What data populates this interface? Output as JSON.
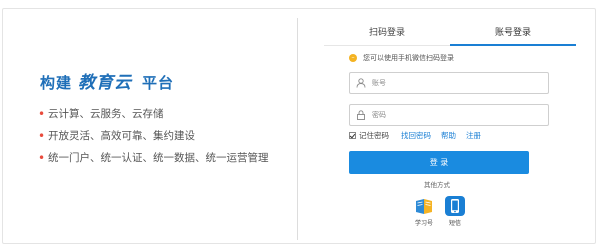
{
  "left": {
    "tagline": {
      "part1": "构建",
      "part2": "教育云",
      "part3": "平台"
    },
    "features": [
      "云计算、云服务、云存储",
      "开放灵活、高效可靠、集约建设",
      "统一门户、统一认证、统一数据、统一运营管理"
    ],
    "bullet_color": "#e94b3c",
    "tagline_color": "#1f6fb8"
  },
  "login": {
    "tabs": [
      {
        "label": "扫码登录",
        "active": false
      },
      {
        "label": "账号登录",
        "active": true
      }
    ],
    "hint": "您可以使用手机微信扫码登录",
    "username_placeholder": "账号",
    "password_placeholder": "密码",
    "remember_label": "记住密码",
    "links": {
      "forgot": "找回密码",
      "help": "帮助",
      "register": "注册"
    },
    "submit_label": "登 录",
    "other_methods_label": "其他方式",
    "alt_methods": [
      {
        "label": "学习号",
        "icon": "study-app-icon"
      },
      {
        "label": "短信",
        "icon": "phone-sms-icon"
      }
    ],
    "accent_color": "#1a8be0"
  }
}
